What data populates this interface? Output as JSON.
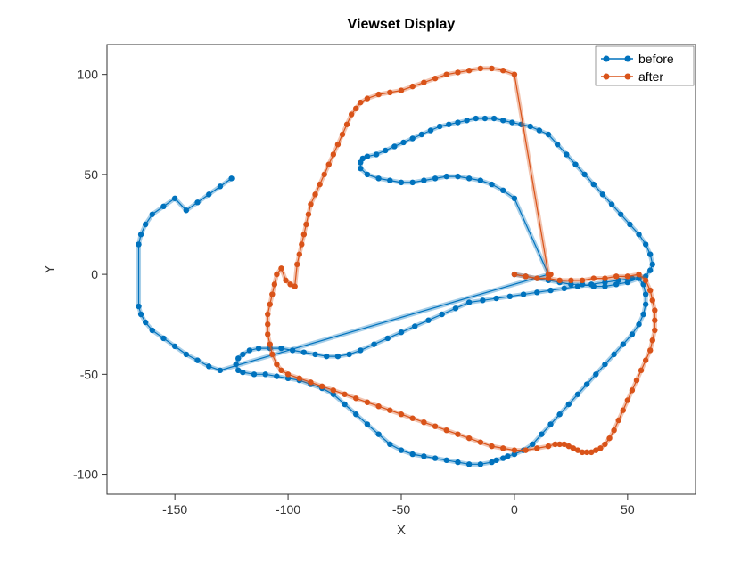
{
  "chart_data": {
    "type": "line",
    "title": "Viewset Display",
    "xlabel": "X",
    "ylabel": "Y",
    "xlim": [
      -180,
      80
    ],
    "ylim": [
      -110,
      115
    ],
    "xticks": [
      -150,
      -100,
      -50,
      0,
      50
    ],
    "yticks": [
      -100,
      -50,
      0,
      50,
      100
    ],
    "series": [
      {
        "name": "before",
        "color": "#0072BD",
        "x": [
          0,
          5,
          10,
          15,
          20,
          25,
          30,
          35,
          40,
          45,
          50,
          55,
          57,
          58,
          58,
          57,
          55,
          52,
          48,
          44,
          40,
          36,
          32,
          28,
          24,
          20,
          16,
          12,
          8,
          4,
          0,
          -3,
          -5,
          -8,
          -10,
          -15,
          -20,
          -25,
          -30,
          -35,
          -40,
          -45,
          -50,
          -55,
          -60,
          -65,
          -70,
          -75,
          -80,
          -85,
          -90,
          -95,
          -100,
          -105,
          -110,
          -115,
          -120,
          -122,
          -123,
          -122,
          -120,
          -117,
          -113,
          -108,
          -103,
          -98,
          -93,
          -88,
          -83,
          -78,
          -73,
          -68,
          -62,
          -56,
          -50,
          -44,
          -38,
          -32,
          -26,
          -20,
          -14,
          -8,
          -2,
          4,
          10,
          16,
          22,
          28,
          34,
          40,
          46,
          52,
          58,
          60,
          61,
          60,
          58,
          55,
          51,
          47,
          43,
          39,
          35,
          31,
          27,
          23,
          19,
          15,
          11,
          7,
          3,
          -1,
          -5,
          -9,
          -13,
          -17,
          -21,
          -25,
          -29,
          -33,
          -37,
          -41,
          -45,
          -49,
          -53,
          -57,
          -61,
          -65,
          -67,
          -68,
          -68,
          -65,
          -60,
          -55,
          -50,
          -45,
          -40,
          -35,
          -30,
          -25,
          -20,
          -15,
          -10,
          -5,
          0,
          15,
          -130,
          -135,
          -140,
          -145,
          -150,
          -155,
          -160,
          -163,
          -165,
          -166,
          -166,
          -165,
          -163,
          -160,
          -155,
          -150,
          -145,
          -140,
          -135,
          -130,
          -125
        ],
        "y": [
          0,
          -1,
          -2,
          -3,
          -4,
          -5,
          -5,
          -6,
          -6,
          -5,
          -4,
          -2,
          -5,
          -10,
          -15,
          -20,
          -25,
          -30,
          -35,
          -40,
          -45,
          -50,
          -55,
          -60,
          -65,
          -70,
          -75,
          -80,
          -85,
          -88,
          -90,
          -91,
          -92,
          -93,
          -94,
          -95,
          -95,
          -94,
          -93,
          -92,
          -91,
          -90,
          -88,
          -85,
          -80,
          -75,
          -70,
          -65,
          -60,
          -57,
          -55,
          -53,
          -52,
          -51,
          -50,
          -50,
          -49,
          -48,
          -45,
          -42,
          -40,
          -38,
          -37,
          -37,
          -37,
          -38,
          -39,
          -40,
          -41,
          -41,
          -40,
          -38,
          -35,
          -32,
          -29,
          -26,
          -23,
          -20,
          -17,
          -14,
          -13,
          -12,
          -11,
          -10,
          -9,
          -8,
          -7,
          -6,
          -5,
          -4,
          -3,
          -2,
          -1,
          2,
          5,
          10,
          15,
          20,
          25,
          30,
          35,
          40,
          45,
          50,
          55,
          60,
          65,
          70,
          72,
          74,
          75,
          76,
          77,
          78,
          78,
          78,
          77,
          76,
          75,
          74,
          72,
          70,
          68,
          66,
          64,
          62,
          60,
          59,
          58,
          56,
          53,
          50,
          48,
          47,
          46,
          46,
          47,
          48,
          49,
          49,
          48,
          47,
          45,
          42,
          38,
          0,
          -48,
          -46,
          -43,
          -40,
          -36,
          -32,
          -28,
          -24,
          -20,
          -16,
          15,
          20,
          25,
          30,
          34,
          38,
          32,
          36,
          40,
          44,
          48
        ]
      },
      {
        "name": "after",
        "color": "#D95319",
        "x": [
          0,
          5,
          10,
          15,
          20,
          25,
          30,
          35,
          40,
          45,
          50,
          55,
          58,
          60,
          61,
          62,
          62,
          62,
          61,
          60,
          58,
          56,
          54,
          52,
          50,
          48,
          46,
          44,
          42,
          40,
          38,
          36,
          34,
          32,
          30,
          28,
          26,
          24,
          22,
          20,
          18,
          15,
          10,
          5,
          0,
          -5,
          -10,
          -15,
          -20,
          -25,
          -30,
          -35,
          -40,
          -45,
          -50,
          -55,
          -60,
          -65,
          -70,
          -75,
          -80,
          -85,
          -90,
          -95,
          -100,
          -103,
          -105,
          -107,
          -108,
          -109,
          -109,
          -109,
          -108,
          -107,
          -106,
          -105,
          -103,
          -101,
          -99,
          -97,
          -96,
          -95,
          -94,
          -93,
          -92,
          -91,
          -90,
          -88,
          -86,
          -84,
          -82,
          -80,
          -78,
          -76,
          -74,
          -72,
          -70,
          -68,
          -65,
          -60,
          -55,
          -50,
          -45,
          -40,
          -35,
          -30,
          -25,
          -20,
          -15,
          -10,
          -5,
          0,
          15,
          16
        ],
        "y": [
          0,
          -1,
          -2,
          -2,
          -3,
          -3,
          -3,
          -2,
          -2,
          -1,
          -1,
          0,
          -3,
          -8,
          -13,
          -18,
          -23,
          -28,
          -33,
          -38,
          -43,
          -48,
          -53,
          -58,
          -63,
          -68,
          -73,
          -78,
          -82,
          -85,
          -87,
          -88,
          -89,
          -89,
          -89,
          -88,
          -87,
          -86,
          -85,
          -85,
          -85,
          -86,
          -87,
          -88,
          -88,
          -87,
          -86,
          -84,
          -82,
          -80,
          -78,
          -76,
          -74,
          -72,
          -70,
          -68,
          -66,
          -64,
          -62,
          -60,
          -58,
          -56,
          -54,
          -52,
          -50,
          -48,
          -45,
          -40,
          -35,
          -30,
          -25,
          -20,
          -15,
          -10,
          -5,
          0,
          3,
          -3,
          -5,
          -6,
          5,
          10,
          15,
          20,
          25,
          30,
          35,
          40,
          45,
          50,
          55,
          60,
          65,
          70,
          75,
          80,
          83,
          86,
          88,
          90,
          91,
          92,
          94,
          96,
          98,
          100,
          101,
          102,
          103,
          103,
          102,
          100,
          0,
          0
        ]
      }
    ],
    "legend": {
      "position": "upper-right",
      "entries": [
        "before",
        "after"
      ]
    }
  }
}
